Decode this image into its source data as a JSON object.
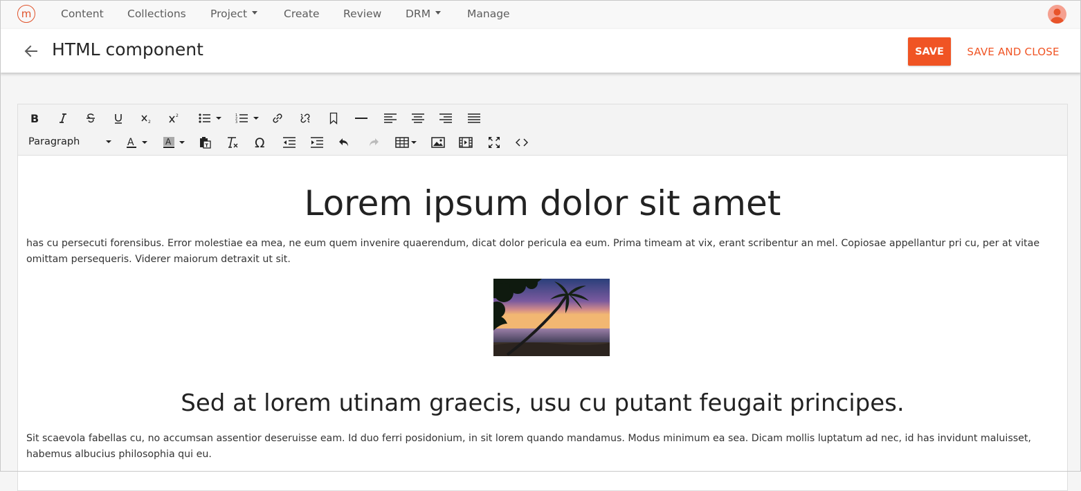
{
  "nav": {
    "logo_letter": "m",
    "items": [
      {
        "label": "Content",
        "dropdown": false
      },
      {
        "label": "Collections",
        "dropdown": false
      },
      {
        "label": "Project",
        "dropdown": true
      },
      {
        "label": "Create",
        "dropdown": false
      },
      {
        "label": "Review",
        "dropdown": false
      },
      {
        "label": "DRM",
        "dropdown": true
      },
      {
        "label": "Manage",
        "dropdown": false
      }
    ],
    "user_icon": "user-avatar-icon"
  },
  "header": {
    "back_icon": "arrow-left-icon",
    "title": "HTML component",
    "save_label": "SAVE",
    "save_close_label": "SAVE AND CLOSE"
  },
  "editor": {
    "toolbar_row1": [
      "bold-icon",
      "italic-icon",
      "strikethrough-icon",
      "underline-icon",
      "subscript-icon",
      "superscript-icon",
      "bullet-list-icon",
      "numbered-list-icon",
      "link-icon",
      "unlink-icon",
      "bookmark-icon",
      "horizontal-rule-icon",
      "align-left-icon",
      "align-center-icon",
      "align-right-icon",
      "align-justify-icon"
    ],
    "toolbar_row2": [
      "text-color-icon",
      "background-color-icon",
      "paste-text-icon",
      "clear-formatting-icon",
      "special-character-icon",
      "outdent-icon",
      "indent-icon",
      "undo-icon",
      "redo-icon",
      "table-icon",
      "image-icon",
      "media-icon",
      "fullscreen-icon",
      "source-code-icon"
    ],
    "block_format": "Paragraph",
    "heading1": "Lorem ipsum dolor sit amet",
    "paragraph1": "has cu persecuti forensibus. Error molestiae ea mea, ne eum quem invenire quaerendum, dicat dolor pericula ea eum. Prima timeam at vix, erant scribentur an mel. Copiosae appellantur pri cu, per at vitae omittam persequeris. Viderer maiorum detraxit ut sit.",
    "image_icon": "beach-palm-sunset-image",
    "heading2": "Sed at lorem utinam graecis, usu cu putant feugait principes.",
    "paragraph2": "Sit scaevola fabellas cu, no accumsan assentior deseruisse eam. Id duo ferri posidonium, in sit lorem quando mandamus. Modus minimum ea sea. Dicam mollis luptatum ad nec, id has invidunt maluisset, habemus albucius philosophia qui eu."
  },
  "colors": {
    "accent": "#f05424",
    "logo": "#e0532b",
    "nav_bg": "#f8f8f8",
    "toolbar_bg": "#f3f3f3"
  }
}
